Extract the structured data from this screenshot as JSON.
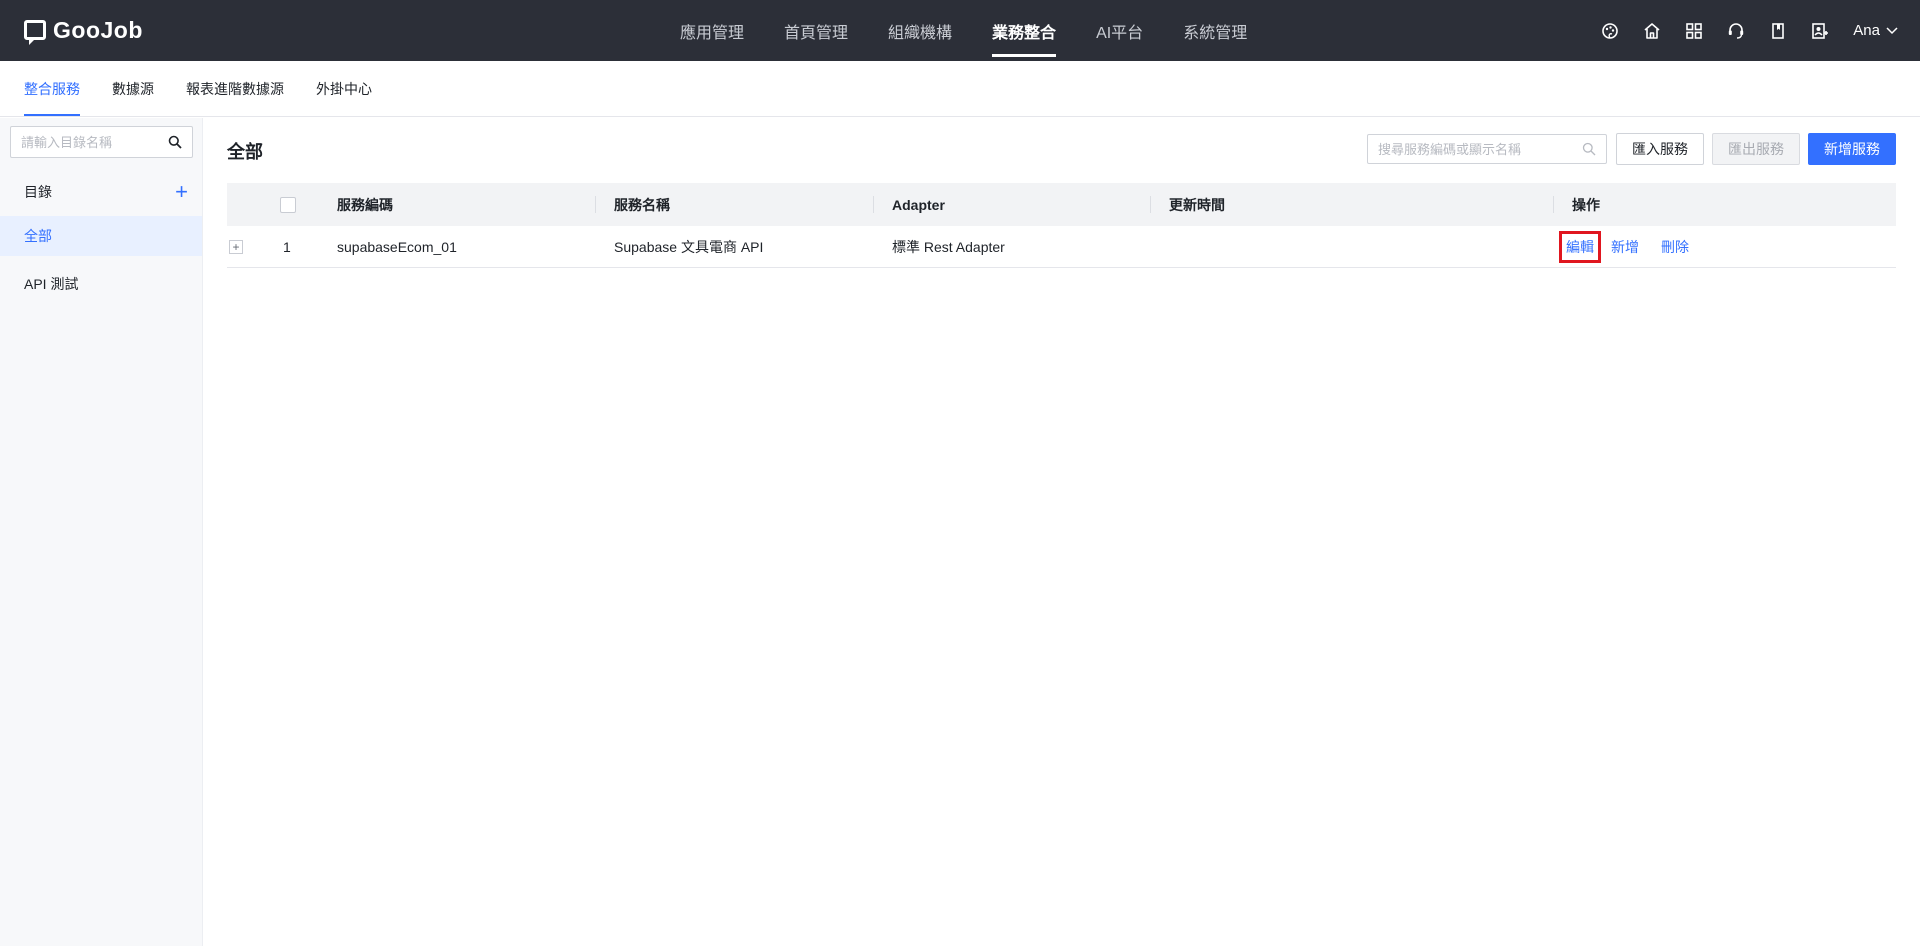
{
  "app": {
    "logo_text": "GooJob"
  },
  "main_nav": [
    {
      "label": "應用管理"
    },
    {
      "label": "首頁管理"
    },
    {
      "label": "組織機構"
    },
    {
      "label": "業務整合",
      "active": true
    },
    {
      "label": "AI平台"
    },
    {
      "label": "系統管理"
    }
  ],
  "top_right": {
    "icons": [
      "palette-icon",
      "home-icon",
      "apps-grid-icon",
      "support-icon",
      "book-icon",
      "user-add-icon"
    ],
    "user_name": "Ana"
  },
  "sub_nav": [
    {
      "label": "整合服務",
      "active": true
    },
    {
      "label": "數據源"
    },
    {
      "label": "報表進階數據源"
    },
    {
      "label": "外掛中心"
    }
  ],
  "sidebar": {
    "search_placeholder": "請輸入目錄名稱",
    "header": "目錄",
    "items": [
      {
        "label": "全部",
        "active": true
      },
      {
        "label": "API 測試"
      }
    ]
  },
  "main": {
    "title": "全部",
    "search_placeholder": "搜尋服務編碼或顯示名稱",
    "import_label": "匯入服務",
    "export_label": "匯出服務",
    "add_label": "新增服務",
    "columns": [
      "服務編碼",
      "服務名稱",
      "Adapter",
      "更新時間",
      "操作"
    ],
    "rows": [
      {
        "index": "1",
        "code": "supabaseEcom_01",
        "name": "Supabase 文具電商 API",
        "adapter": "標準 Rest Adapter",
        "updated": "",
        "actions": [
          "編輯",
          "新增",
          "刪除"
        ]
      }
    ]
  },
  "colors": {
    "accent": "#3370ff",
    "topbar": "#2c2f38",
    "highlight": "#e0161f"
  }
}
